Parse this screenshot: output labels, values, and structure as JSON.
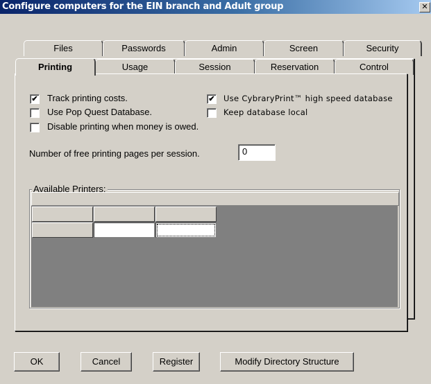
{
  "window": {
    "title": "Configure computers for the EIN branch and Adult group",
    "close_glyph": "✕"
  },
  "tabs": {
    "back_row": [
      "Files",
      "Passwords",
      "Admin",
      "Screen",
      "Security"
    ],
    "front_row": [
      "Printing",
      "Usage",
      "Session",
      "Reservation",
      "Control"
    ],
    "active": "Printing"
  },
  "printing": {
    "track_costs": {
      "label": "Track printing costs.",
      "checked": true
    },
    "pop_quest": {
      "label": "Use Pop Quest Database.",
      "checked": false
    },
    "disable_owed": {
      "label": "Disable printing when money is owed.",
      "checked": false
    },
    "cybraryprint": {
      "label": "Use CybraryPrint™ high speed database",
      "checked": true
    },
    "keep_local": {
      "label": "Keep database local",
      "checked": false
    },
    "free_pages": {
      "label": "Number of free printing pages per session.",
      "value": "0"
    },
    "printers_group_label": "Available Printers:"
  },
  "buttons": {
    "ok": "OK",
    "cancel": "Cancel",
    "register": "Register",
    "modify": "Modify Directory Structure"
  },
  "check_glyph": "✔"
}
